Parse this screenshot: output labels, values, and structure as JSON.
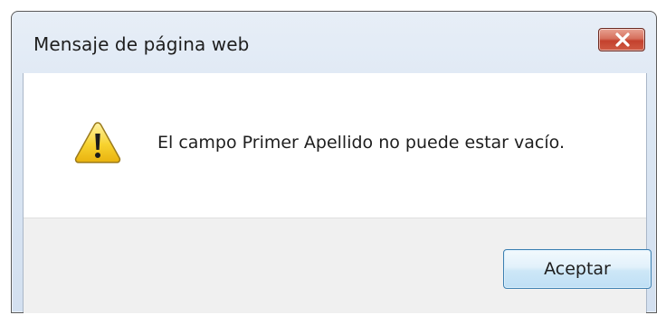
{
  "dialog": {
    "title": "Mensaje de página web",
    "close_icon": "close-icon",
    "warning_icon": "warning-icon",
    "message": "El campo Primer Apellido no puede estar vacío.",
    "ok_label": "Aceptar"
  },
  "colors": {
    "close_button": "#c4412d",
    "button_border": "#3c7fb1",
    "footer_background": "#f0f0f0"
  }
}
